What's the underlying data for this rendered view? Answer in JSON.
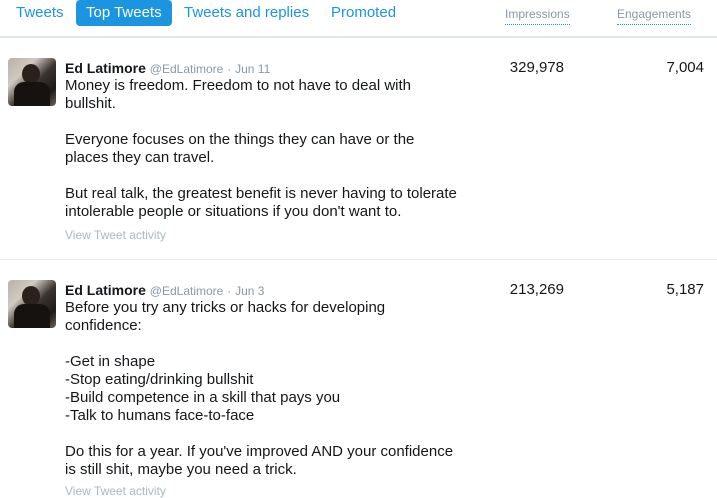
{
  "tabs": [
    {
      "label": "Tweets",
      "active": false
    },
    {
      "label": "Top Tweets",
      "active": true
    },
    {
      "label": "Tweets and replies",
      "active": false
    },
    {
      "label": "Promoted",
      "active": false
    }
  ],
  "columns": {
    "impressions": "Impressions",
    "engagements": "Engagements"
  },
  "tweets": [
    {
      "name": "Ed Latimore",
      "handle": "@EdLatimore",
      "sep": "·",
      "date": "Jun 11",
      "lines": [
        "Money is freedom. Freedom to not have to deal with",
        "bullshit.",
        "",
        "Everyone focuses on the things they can have or the",
        "places they can travel.",
        "",
        "But real talk, the greatest benefit is never having to tolerate",
        "intolerable people or situations if you don't want to."
      ],
      "activity": "View Tweet activity",
      "impressions": "329,978",
      "engagements": "7,004"
    },
    {
      "name": "Ed Latimore",
      "handle": "@EdLatimore",
      "sep": "·",
      "date": "Jun 3",
      "lines": [
        "Before you try any tricks or hacks for developing",
        "confidence:",
        "",
        "-Get in shape",
        "-Stop eating/drinking bullshit",
        "-Build competence in a skill that pays you",
        "-Talk to humans face-to-face",
        "",
        "Do this for a year. If you've improved AND your confidence",
        "is still shit, maybe you need a trick."
      ],
      "activity": "View Tweet activity",
      "impressions": "213,269",
      "engagements": "5,187"
    }
  ]
}
